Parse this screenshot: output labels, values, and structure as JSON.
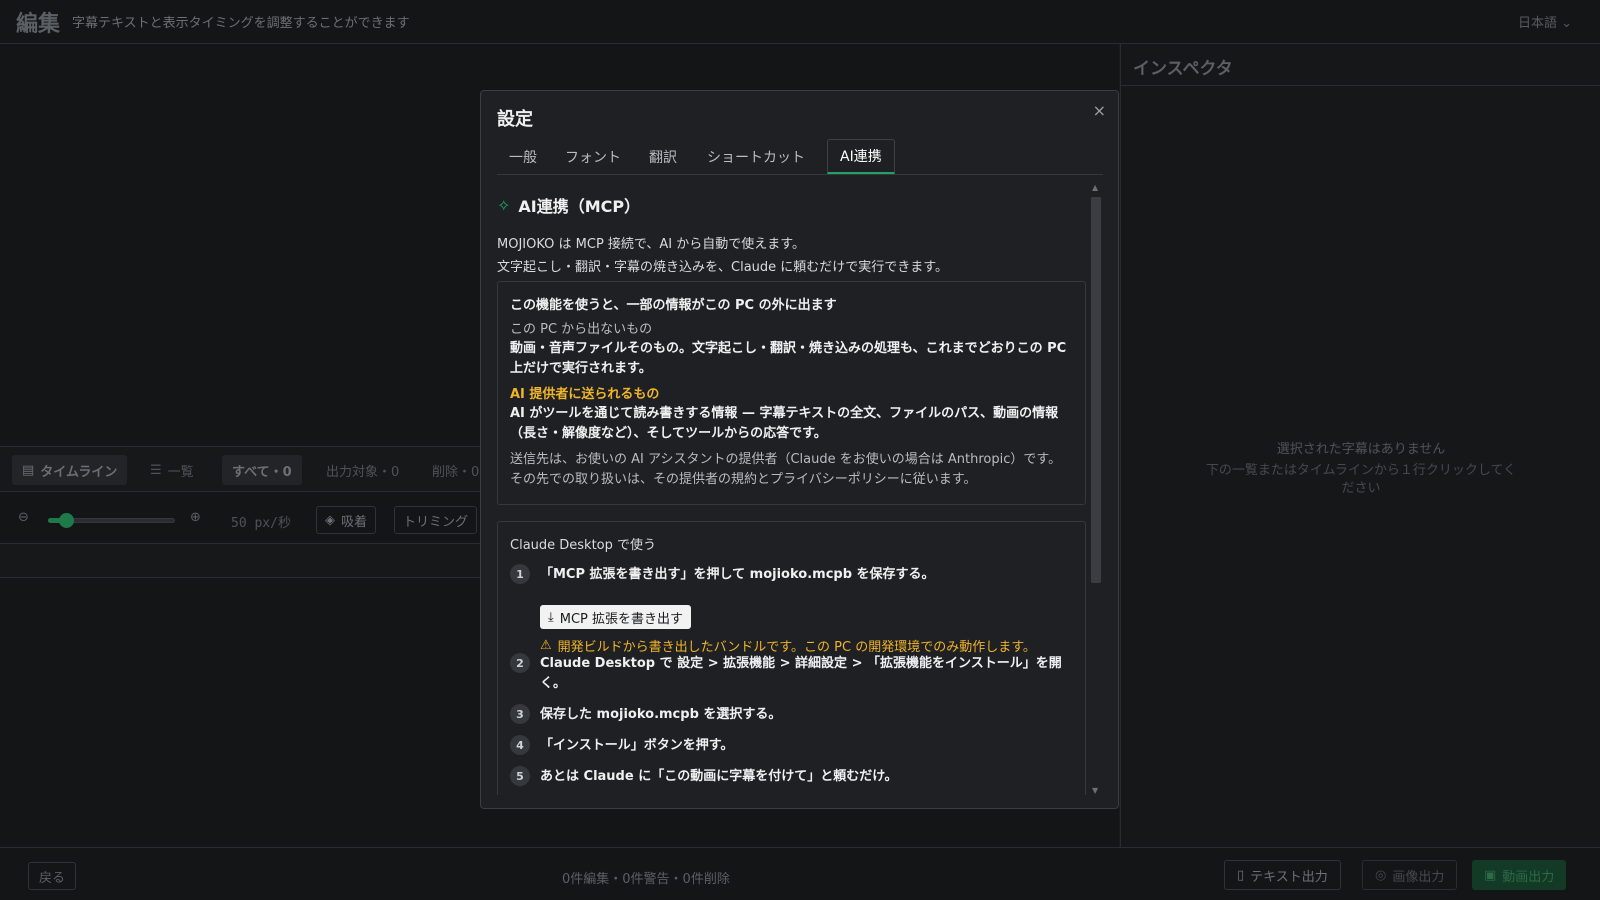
{
  "header": {
    "title": "編集",
    "subtitle": "字幕テキストと表示タイミングを調整することができます",
    "language": "日本語 ⌄"
  },
  "inspector": {
    "title": "インスペクタ",
    "empty_title": "選択された字幕はありません",
    "empty_hint": "下の一覧またはタイムラインから１行クリックしてください"
  },
  "timeline": {
    "tab_timeline": "タイムライン",
    "tab_list": "一覧",
    "filter_all": "すべて・0",
    "filter_output": "出力対象・0",
    "filter_delete": "削除・0",
    "zoom_label": "50 px/秒",
    "zoom_level": 0.1,
    "snap_label": "吸着",
    "trim_label": "トリミング"
  },
  "footer": {
    "back": "戻る",
    "status": "0件編集・0件警告・0件削除",
    "text_export": "テキスト出力",
    "image_export": "画像出力",
    "video_export": "動画出力"
  },
  "modal": {
    "title": "設定",
    "close": "×",
    "tabs": [
      {
        "label": "一般"
      },
      {
        "label": "フォント"
      },
      {
        "label": "翻訳"
      },
      {
        "label": "ショートカット"
      },
      {
        "label": "AI連携"
      }
    ],
    "active_tab": "AI連携",
    "section_title": "AI連携（MCP）",
    "intro_1": "MOJIOKO は MCP 接続で、AI から自動で使えます。",
    "intro_2": "文字起こし・翻訳・字幕の焼き込みを、Claude に頼むだけで実行できます。",
    "privacy": {
      "heading": "この機能を使うと、一部の情報がこの PC の外に出ます",
      "local_head": "この PC から出ないもの",
      "local_text": "動画・音声ファイルそのもの。文字起こし・翻訳・焼き込みの処理も、これまでどおりこの PC 上だけで実行されます。",
      "sent_head": "AI 提供者に送られるもの",
      "sent_text": "AI がツールを通じて読み書きする情報 — 字幕テキストの全文、ファイルのパス、動画の情報（長さ・解像度など）、そしてツールからの応答です。",
      "dest_text": "送信先は、お使いの AI アシスタントの提供者（Claude をお使いの場合は Anthropic）です。その先での取り扱いは、その提供者の規約とプライバシーポリシーに従います。"
    },
    "desktop": {
      "heading": "Claude Desktop で使う",
      "steps": [
        {
          "num": "1",
          "text": "「MCP 拡張を書き出す」を押して mojioko.mcpb を保存する。"
        },
        {
          "num": "2",
          "text": "Claude Desktop で 設定 > 拡張機能 > 詳細設定 > 「拡張機能をインストール」を開く。"
        },
        {
          "num": "3",
          "text": "保存した mojioko.mcpb を選択する。"
        },
        {
          "num": "4",
          "text": "「インストール」ボタンを押す。"
        },
        {
          "num": "5",
          "text": "あとは Claude に「この動画に字幕を付けて」と頼むだけ。"
        }
      ],
      "export_button": "MCP 拡張を書き出す",
      "dev_warning": "開発ビルドから書き出したバンドルです。この PC の開発環境でのみ動作します。"
    }
  },
  "colors": {
    "accent": "#21a366",
    "warning": "#f0b429"
  }
}
